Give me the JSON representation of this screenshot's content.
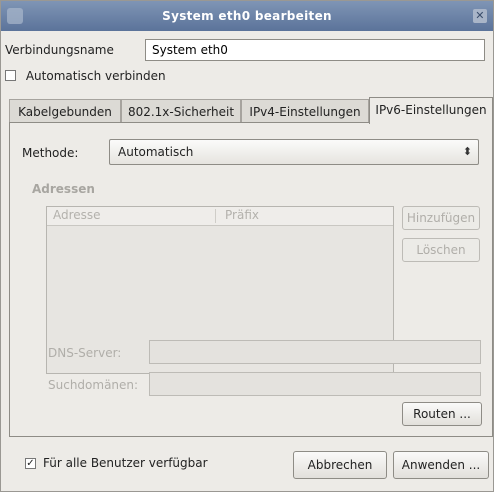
{
  "window": {
    "title": "System eth0 bearbeiten",
    "close_icon": "close-icon"
  },
  "connection_name": {
    "label": "Verbindungsname",
    "value": "System eth0"
  },
  "auto_connect": {
    "label": "Automatisch verbinden",
    "checked": false
  },
  "tabs": [
    {
      "label": "Kabelgebunden",
      "active": false
    },
    {
      "label": "802.1x-Sicherheit",
      "active": false
    },
    {
      "label": "IPv4-Einstellungen",
      "active": false
    },
    {
      "label": "IPv6-Einstellungen",
      "active": true
    }
  ],
  "ipv6": {
    "method_label": "Methode:",
    "method_value": "Automatisch",
    "addresses_heading": "Adressen",
    "table_headers": [
      "Adresse",
      "Präfix"
    ],
    "add_button": "Hinzufügen",
    "delete_button": "Löschen",
    "dns_label": "DNS-Server:",
    "search_domains_label": "Suchdomänen:",
    "routes_button": "Routen ..."
  },
  "footer": {
    "all_users_label": "Für alle Benutzer verfügbar",
    "all_users_checked": true,
    "cancel_button": "Abbrechen",
    "apply_button": "Anwenden ..."
  },
  "colors": {
    "titlebar": "#6a82a8",
    "window_bg": "#edebe7",
    "disabled_text": "#b0aea9"
  }
}
